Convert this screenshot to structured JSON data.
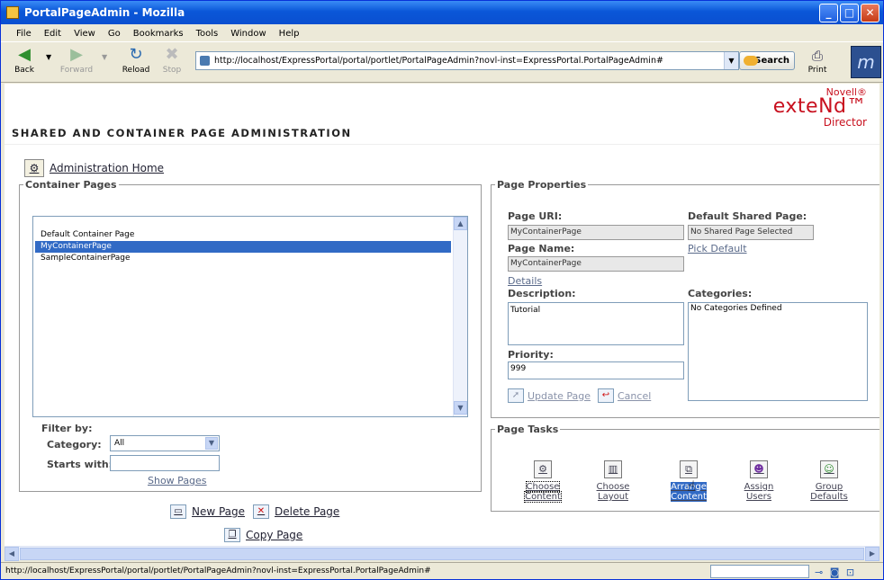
{
  "window": {
    "title": "PortalPageAdmin - Mozilla"
  },
  "menu": [
    "File",
    "Edit",
    "View",
    "Go",
    "Bookmarks",
    "Tools",
    "Window",
    "Help"
  ],
  "nav": {
    "back": "Back",
    "forward": "Forward",
    "reload": "Reload",
    "stop": "Stop",
    "url": "http://localhost/ExpressPortal/portal/portlet/PortalPageAdmin?novl-inst=ExpressPortal.PortalPageAdmin#",
    "search": "Search",
    "print": "Print"
  },
  "banner": {
    "title": "SHARED AND CONTAINER PAGE ADMINISTRATION",
    "brand_top": "Novell®",
    "brand_mid": "exteNd™",
    "brand_bot": "Director"
  },
  "home_link": "Administration Home",
  "container_pages": {
    "legend": "Container Pages",
    "items": [
      "Default Container Page",
      "MyContainerPage",
      "SampleContainerPage"
    ],
    "filter_label": "Filter by:",
    "category_label": "Category:",
    "category_value": "All",
    "starts_with_label": "Starts with:",
    "starts_with_value": "",
    "show_pages": "Show Pages"
  },
  "page_actions": {
    "new_page": "New Page",
    "delete_page": "Delete Page",
    "copy_page": "Copy Page"
  },
  "properties": {
    "legend": "Page Properties",
    "uri_label": "Page URI:",
    "uri_value": "MyContainerPage",
    "default_shared_label": "Default Shared Page:",
    "default_shared_value": "No Shared Page Selected",
    "name_label": "Page Name:",
    "name_value": "MyContainerPage",
    "pick_default": "Pick Default",
    "details": "Details",
    "description_label": "Description:",
    "description_value": "Tutorial",
    "categories_label": "Categories:",
    "categories_value": "No Categories Defined",
    "priority_label": "Priority:",
    "priority_value": "999",
    "update_page": "Update Page",
    "cancel": "Cancel"
  },
  "tasks": {
    "legend": "Page Tasks",
    "items": [
      {
        "l1": "Choose",
        "l2": "Content"
      },
      {
        "l1": "Choose",
        "l2": "Layout"
      },
      {
        "l1": "Arrange",
        "l2": "Content"
      },
      {
        "l1": "Assign",
        "l2": "Users"
      },
      {
        "l1": "Group",
        "l2": "Defaults"
      }
    ]
  },
  "status": {
    "text": "http://localhost/ExpressPortal/portal/portlet/PortalPageAdmin?novl-inst=ExpressPortal.PortalPageAdmin#"
  }
}
